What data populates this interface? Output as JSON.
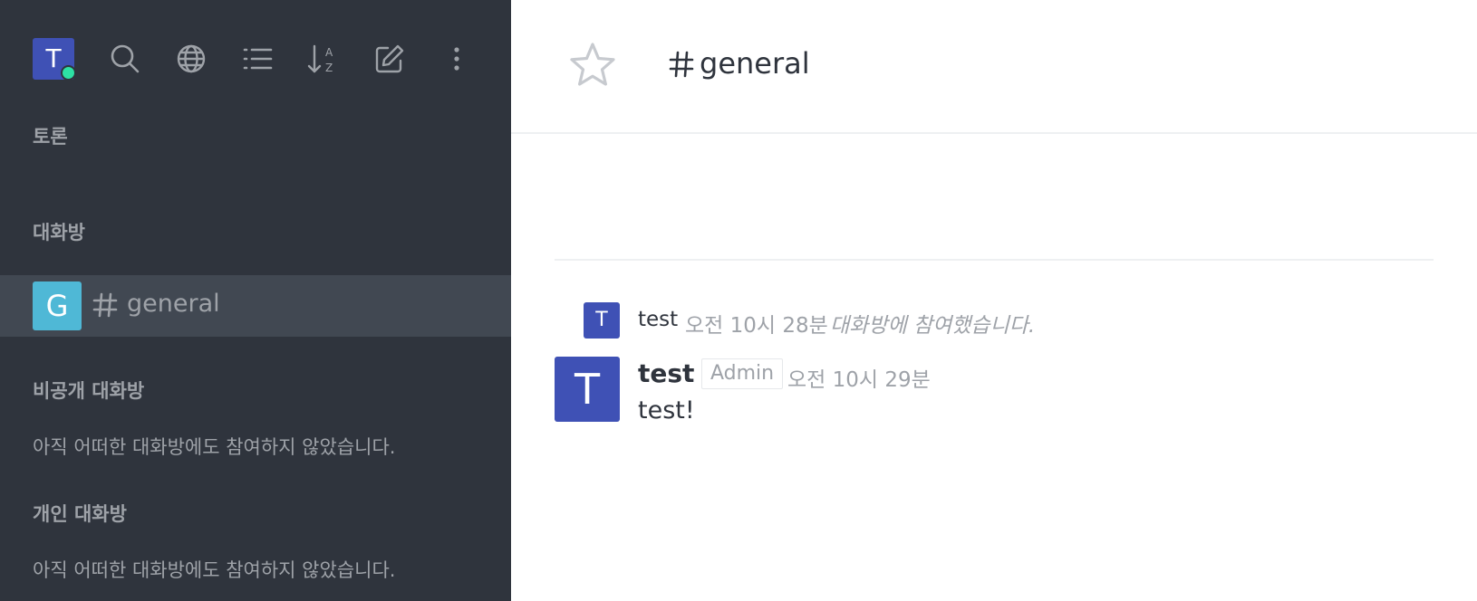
{
  "colors": {
    "sidebar_bg": "#2f343d",
    "sidebar_selected_bg": "#414852",
    "user_avatar_bg": "#3f51b5",
    "room_avatar_bg": "#4fb8d6",
    "status_online": "#2de0a5",
    "icon_color": "#9ea2a8"
  },
  "user": {
    "initial": "T",
    "status": "online"
  },
  "toolbar": {
    "icons": [
      "search-icon",
      "directory-globe-icon",
      "display-list-icon",
      "sort-az-icon",
      "create-new-edit-icon",
      "more-menu-icon"
    ],
    "sort_glyph_top": "A",
    "sort_glyph_bottom": "Z"
  },
  "sidebar": {
    "sections": {
      "discussions": "토론",
      "channels": "대화방",
      "private": "비공개 대화방",
      "direct": "개인 대화방"
    },
    "rooms": [
      {
        "initial": "G",
        "name": "general"
      }
    ],
    "empty_private": "아직 어떠한 대화방에도 참여하지 않았습니다.",
    "empty_direct": "아직 어떠한 대화방에도 참여하지 않았습니다."
  },
  "header": {
    "room_name": "general"
  },
  "messages": [
    {
      "type": "system",
      "avatar_initial": "T",
      "user": "test",
      "time": "오전 10시 28분",
      "text": "대화방에 참여했습니다."
    },
    {
      "type": "message",
      "avatar_initial": "T",
      "user": "test",
      "role": "Admin",
      "time": "오전 10시 29분",
      "text": "test!"
    }
  ]
}
